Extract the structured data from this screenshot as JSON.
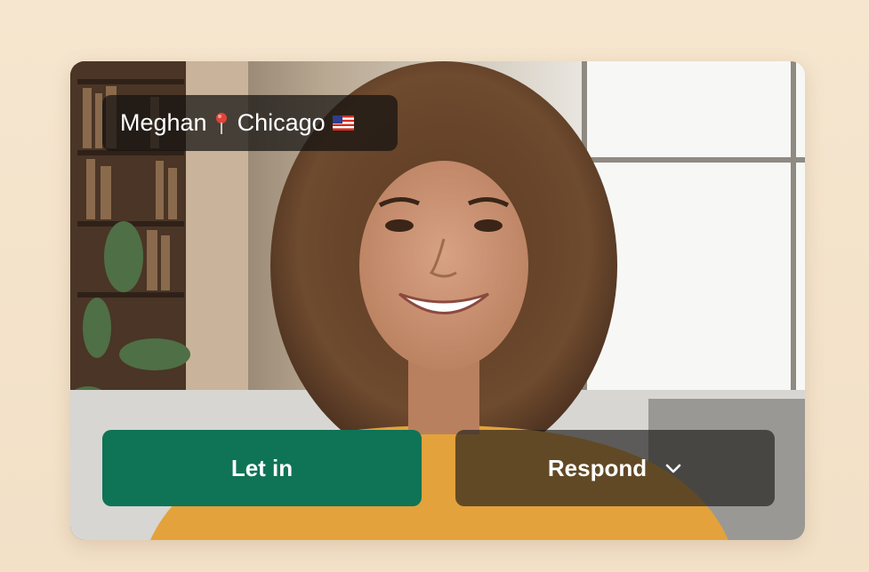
{
  "caller": {
    "name": "Meghan",
    "location": "Chicago",
    "pin_icon": "pin-icon",
    "flag_icon": "us-flag-icon"
  },
  "actions": {
    "let_in_label": "Let in",
    "respond_label": "Respond",
    "respond_icon": "chevron-down-icon"
  },
  "colors": {
    "page_background": "#f6e6cf",
    "let_in_button": "#0f7356",
    "respond_button": "#1e1c1a",
    "overlay_text": "#ffffff"
  }
}
